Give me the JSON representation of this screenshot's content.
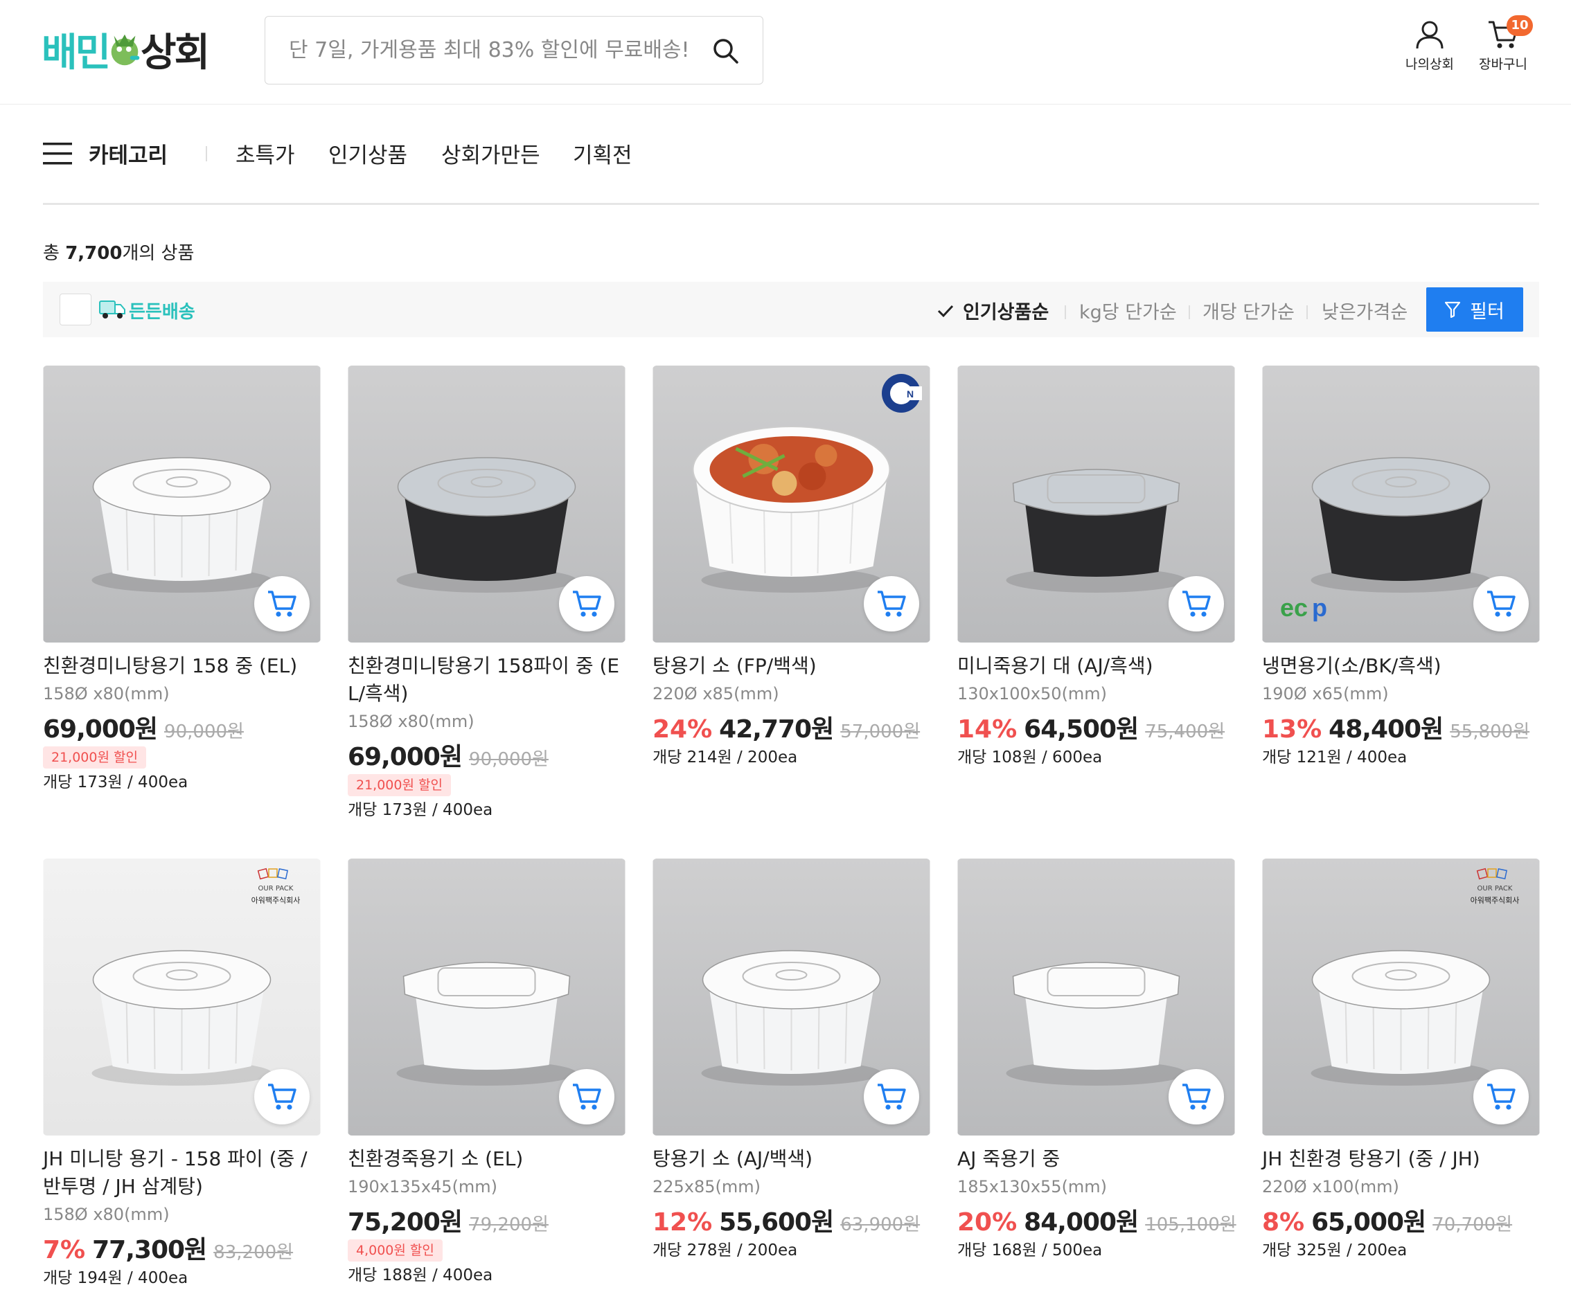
{
  "header": {
    "logo_part1": "배민",
    "logo_part2": "상회",
    "search_placeholder": "단 7일, 가게용품 최대 83% 할인에 무료배송!",
    "my_label": "나의상회",
    "cart_label": "장바구니",
    "cart_count": "10"
  },
  "nav": {
    "category_label": "카테고리",
    "items": [
      "초특가",
      "인기상품",
      "상회가만든",
      "기획전"
    ]
  },
  "listing": {
    "total_prefix": "총 ",
    "total_count": "7,700",
    "total_suffix": "개의 상품",
    "shipping_filter_label": "든든배송",
    "sort_options": [
      "인기상품순",
      "kg당 단가순",
      "개당 단가순",
      "낮은가격순"
    ],
    "sort_selected": "인기상품순",
    "filter_button": "필터"
  },
  "products": [
    {
      "name": "친환경미니탕용기 158 중 (EL)",
      "size": "158Ø x80(mm)",
      "discount": "",
      "price": "69,000원",
      "original_price": "90,000원",
      "badge": "21,000원 할인",
      "unit_price": "개당 173원 / 400ea",
      "image": "round-white-container"
    },
    {
      "name": "친환경미니탕용기 158파이 중 (EL/흑색)",
      "size": "158Ø x80(mm)",
      "discount": "",
      "price": "69,000원",
      "original_price": "90,000원",
      "badge": "21,000원 할인",
      "unit_price": "개당 173원 / 400ea",
      "image": "round-black-container"
    },
    {
      "name": "탕용기 소 (FP/백색)",
      "size": "220Ø x85(mm)",
      "discount": "24%",
      "price": "42,770원",
      "original_price": "57,000원",
      "badge": "",
      "unit_price": "개당 214원 / 200ea",
      "image": "round-white-food-container",
      "brand": "CN"
    },
    {
      "name": "미니죽용기 대 (AJ/흑색)",
      "size": "130x100x50(mm)",
      "discount": "14%",
      "price": "64,500원",
      "original_price": "75,400원",
      "badge": "",
      "unit_price": "개당 108원 / 600ea",
      "image": "rect-black-container"
    },
    {
      "name": "냉면용기(소/BK/흑색)",
      "size": "190Ø x65(mm)",
      "discount": "13%",
      "price": "48,400원",
      "original_price": "55,800원",
      "badge": "",
      "unit_price": "개당 121원 / 400ea",
      "image": "round-black-bowl",
      "brand": "ecp"
    },
    {
      "name": "JH 미니탕 용기 - 158 파이 (중 / 반투명 / JH 삼계탕)",
      "size": "158Ø x80(mm)",
      "discount": "7%",
      "price": "77,300원",
      "original_price": "83,200원",
      "badge": "",
      "unit_price": "개당 194원 / 400ea",
      "image": "round-clear-container",
      "brand": "OUR PACK",
      "brand_sub": "아워팩주식회사"
    },
    {
      "name": "친환경죽용기 소 (EL)",
      "size": "190x135x45(mm)",
      "discount": "",
      "price": "75,200원",
      "original_price": "79,200원",
      "badge": "4,000원 할인",
      "unit_price": "개당 188원 / 400ea",
      "image": "rect-white-container"
    },
    {
      "name": "탕용기 소 (AJ/백색)",
      "size": "225x85(mm)",
      "discount": "12%",
      "price": "55,600원",
      "original_price": "63,900원",
      "badge": "",
      "unit_price": "개당 278원 / 200ea",
      "image": "round-white-container"
    },
    {
      "name": "AJ 죽용기 중",
      "size": "185x130x55(mm)",
      "discount": "20%",
      "price": "84,000원",
      "original_price": "105,100원",
      "badge": "",
      "unit_price": "개당 168원 / 500ea",
      "image": "rect-white-container"
    },
    {
      "name": "JH 친환경 탕용기 (중 / JH)",
      "size": "220Ø x100(mm)",
      "discount": "8%",
      "price": "65,000원",
      "original_price": "70,700원",
      "badge": "",
      "unit_price": "개당 325원 / 200ea",
      "image": "round-white-container",
      "brand": "OUR PACK",
      "brand_sub": "아워팩주식회사"
    }
  ],
  "colors": {
    "brand_mint": "#2ac1bc",
    "accent_blue": "#1f7ef0",
    "discount_red": "#f0504f",
    "badge_orange": "#f2682f"
  }
}
